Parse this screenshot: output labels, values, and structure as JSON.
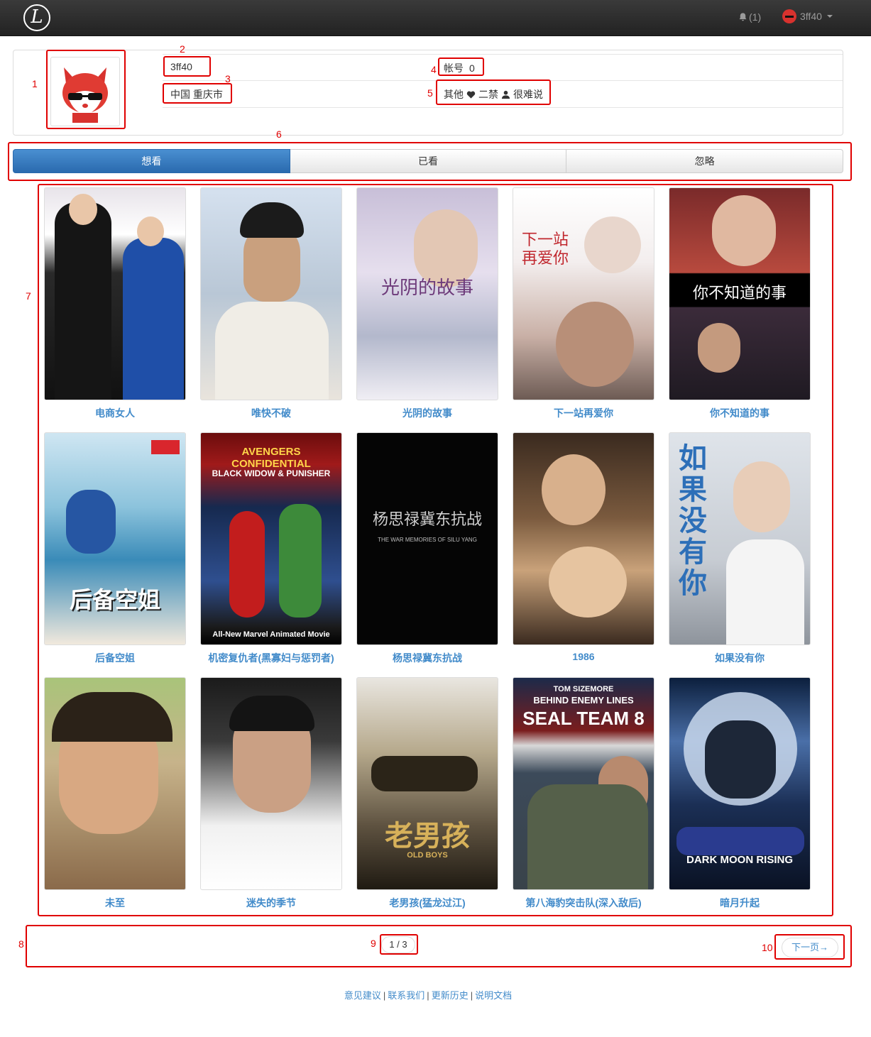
{
  "navbar": {
    "logo_letter": "L",
    "notification_count": "(1)",
    "username": "3ff40"
  },
  "profile": {
    "username": "3ff40",
    "location": "中国 重庆市",
    "account_label": "帐号",
    "account_value": "0",
    "gender": "其他",
    "relationship": "二禁",
    "personality": "很难说"
  },
  "tabs": [
    {
      "label": "想看",
      "active": true
    },
    {
      "label": "已看",
      "active": false
    },
    {
      "label": "忽略",
      "active": false
    }
  ],
  "movies": [
    {
      "title": "电商女人"
    },
    {
      "title": "唯快不破"
    },
    {
      "title": "光阴的故事"
    },
    {
      "title": "下一站再爱你"
    },
    {
      "title": "你不知道的事"
    },
    {
      "title": "后备空姐"
    },
    {
      "title": "机密复仇者(黑寡妇与惩罚者)"
    },
    {
      "title": "杨思禄冀东抗战"
    },
    {
      "title": "1986"
    },
    {
      "title": "如果没有你"
    },
    {
      "title": "未至"
    },
    {
      "title": "迷失的季节"
    },
    {
      "title": "老男孩(猛龙过江)"
    },
    {
      "title": "第八海豹突击队(深入敌后)"
    },
    {
      "title": "暗月升起"
    }
  ],
  "poster_text": {
    "p3": "光阴的故事",
    "p4": "下一站 再爱你",
    "p5": "你不知道的事",
    "p6": "后备空姐",
    "p7": "AVENGERS CONFIDENTIAL",
    "p7b": "BLACK WIDOW & PUNISHER",
    "p7c": "All-New Marvel Animated Movie",
    "p8": "杨思禄冀东抗战",
    "p8b": "THE WAR MEMORIES OF SILU YANG",
    "p10": "如果 没有 你",
    "p13": "老男孩",
    "p13b": "OLD BOYS",
    "p14a": "TOM SIZEMORE",
    "p14b": "BEHIND ENEMY LINES",
    "p14c": "SEAL TEAM 8",
    "p15": "DARK MOON RISING"
  },
  "pagination": {
    "info": "1 / 3",
    "next_label": "下一页→"
  },
  "footer": {
    "links": [
      "意见建议",
      "联系我们",
      "更新历史",
      "说明文档"
    ],
    "separator": "|"
  },
  "annotations": [
    "1",
    "2",
    "3",
    "4",
    "5",
    "6",
    "7",
    "8",
    "9",
    "10"
  ],
  "colors": {
    "link": "#428bca",
    "tab_active": "#2a6aae",
    "annotation": "#e00000",
    "navbar": "#222222"
  }
}
